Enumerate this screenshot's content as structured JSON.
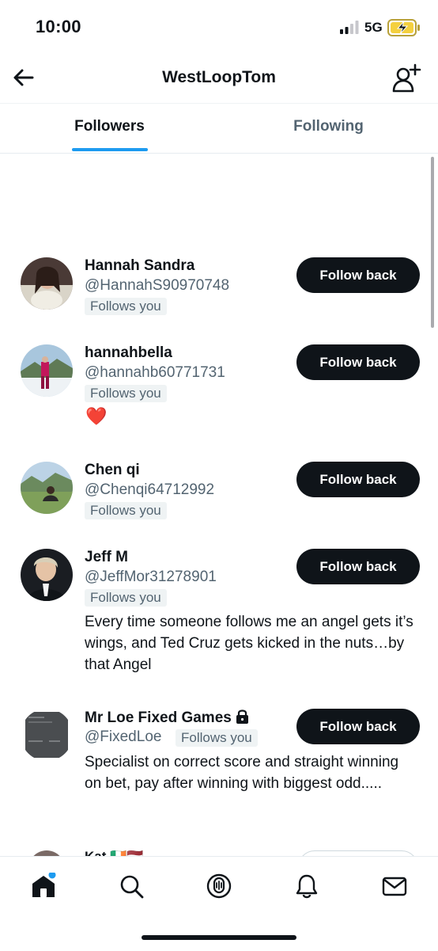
{
  "status_bar": {
    "time": "10:00",
    "network": "5G"
  },
  "header": {
    "title": "WestLoopTom"
  },
  "tabs": [
    {
      "label": "Followers",
      "active": true
    },
    {
      "label": "Following",
      "active": false
    }
  ],
  "users": [
    {
      "name": "Hannah Sandra",
      "handle": "@HannahS90970748",
      "follows_you": "Follows you",
      "button": "Follow back"
    },
    {
      "name": "hannahbella",
      "handle": "@hannahb60771731",
      "follows_you": "Follows you",
      "bio": "❤️",
      "button": "Follow back"
    },
    {
      "name": "Chen qi",
      "handle": "@Chenqi64712992",
      "follows_you": "Follows you",
      "button": "Follow back"
    },
    {
      "name": "Jeff M",
      "handle": "@JeffMor31278901",
      "follows_you": "Follows you",
      "bio": "Every time someone follows me an angel gets it’s wings, and Ted Cruz gets kicked in the nuts…by that Angel",
      "button": "Follow back"
    },
    {
      "name": "Mr Loe Fixed Games",
      "handle": "@FixedLoe",
      "follows_you": "Follows you",
      "bio": "Specialist on correct score and straight winning on bet, pay after winning with biggest odd.....",
      "button": "Follow back"
    },
    {
      "name": "Kat 🇮🇪🇱🇻"
    }
  ],
  "bottom_nav": [
    {
      "icon": "home-icon",
      "active": true,
      "has_notification_dot": true
    },
    {
      "icon": "search-icon"
    },
    {
      "icon": "spaces-icon"
    },
    {
      "icon": "notifications-icon"
    },
    {
      "icon": "messages-icon"
    }
  ],
  "colors": {
    "accent": "#1d9bf0",
    "text": "#0f1419",
    "secondary": "#536471",
    "button": "#0f1419"
  }
}
